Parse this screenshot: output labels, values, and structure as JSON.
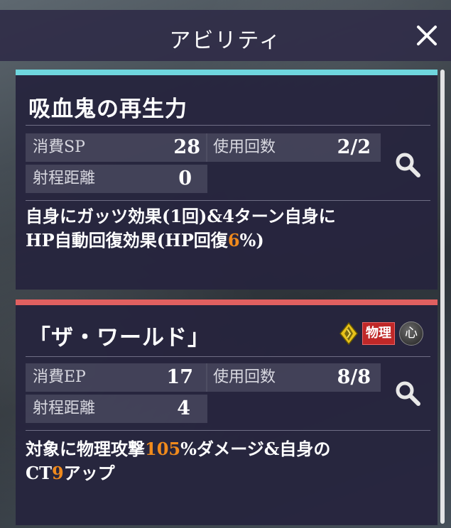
{
  "header": {
    "title": "アビリティ"
  },
  "abilities": [
    {
      "name": "吸血鬼の再生力",
      "cost_label": "消費SP",
      "cost_value": "28",
      "uses_label": "使用回数",
      "uses_value": "2/2",
      "range_label": "射程距離",
      "range_value": "0",
      "desc_line1": "自身にガッツ効果(1回)&4ターン自身に",
      "desc_line2_a": "HP自動回復効果(HP回復",
      "desc_line2_hl": "6",
      "desc_line2_b": "%)"
    },
    {
      "name": "「ザ・ワールド」",
      "cost_label": "消費EP",
      "cost_value": "17",
      "uses_label": "使用回数",
      "uses_value": "8/8",
      "range_label": "射程距離",
      "range_value": "4",
      "attr_badge": "物理",
      "heart_badge": "心",
      "desc_line1_a": "対象に物理攻撃",
      "desc_line1_hl": "105",
      "desc_line1_b": "%ダメージ&自身の",
      "desc_line2_a": "CT",
      "desc_line2_hl": "9",
      "desc_line2_b": "アップ"
    }
  ],
  "colors": {
    "card1_bar": "#6fd6de",
    "card2_bar": "#e06060",
    "highlight": "#f08a1c",
    "physical_badge": "#c02828"
  },
  "icons": [
    "close-icon",
    "search-icon",
    "element-diamond-icon",
    "heart-icon"
  ]
}
